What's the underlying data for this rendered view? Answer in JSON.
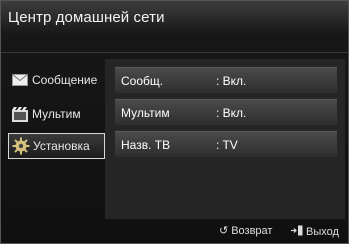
{
  "header": {
    "title": "Центр домашней сети"
  },
  "sidebar": {
    "items": [
      {
        "label": "Сообщение",
        "icon": "envelope-icon",
        "selected": false
      },
      {
        "label": "Мультим",
        "icon": "film-icon",
        "selected": false
      },
      {
        "label": "Установка",
        "icon": "gear-icon",
        "selected": true
      }
    ]
  },
  "settings": {
    "rows": [
      {
        "label": "Сообщ.",
        "value": ": Вкл."
      },
      {
        "label": "Мультим",
        "value": ": Вкл."
      },
      {
        "label": "Назв. ТВ",
        "value": ": TV"
      }
    ]
  },
  "footer": {
    "return_label": "Возврат",
    "exit_label": "Выход"
  }
}
